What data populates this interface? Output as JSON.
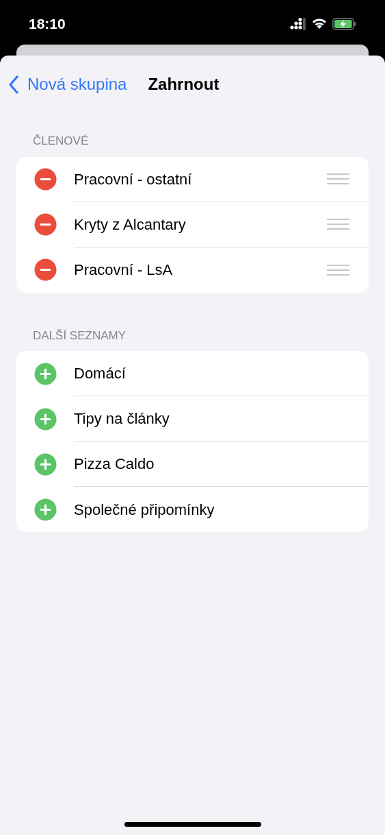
{
  "status_bar": {
    "time": "18:10"
  },
  "nav": {
    "back": "Nová skupina",
    "title": "Zahrnout"
  },
  "sections": [
    {
      "header": "ČLENOVÉ",
      "kind": "remove",
      "items": [
        {
          "label": "Pracovní - ostatní"
        },
        {
          "label": "Kryty z Alcantary"
        },
        {
          "label": "Pracovní - LsA"
        }
      ]
    },
    {
      "header": "DALŠÍ SEZNAMY",
      "kind": "add",
      "items": [
        {
          "label": "Domácí"
        },
        {
          "label": "Tipy na články"
        },
        {
          "label": "Pizza Caldo"
        },
        {
          "label": "Společné připomínky"
        }
      ]
    }
  ]
}
